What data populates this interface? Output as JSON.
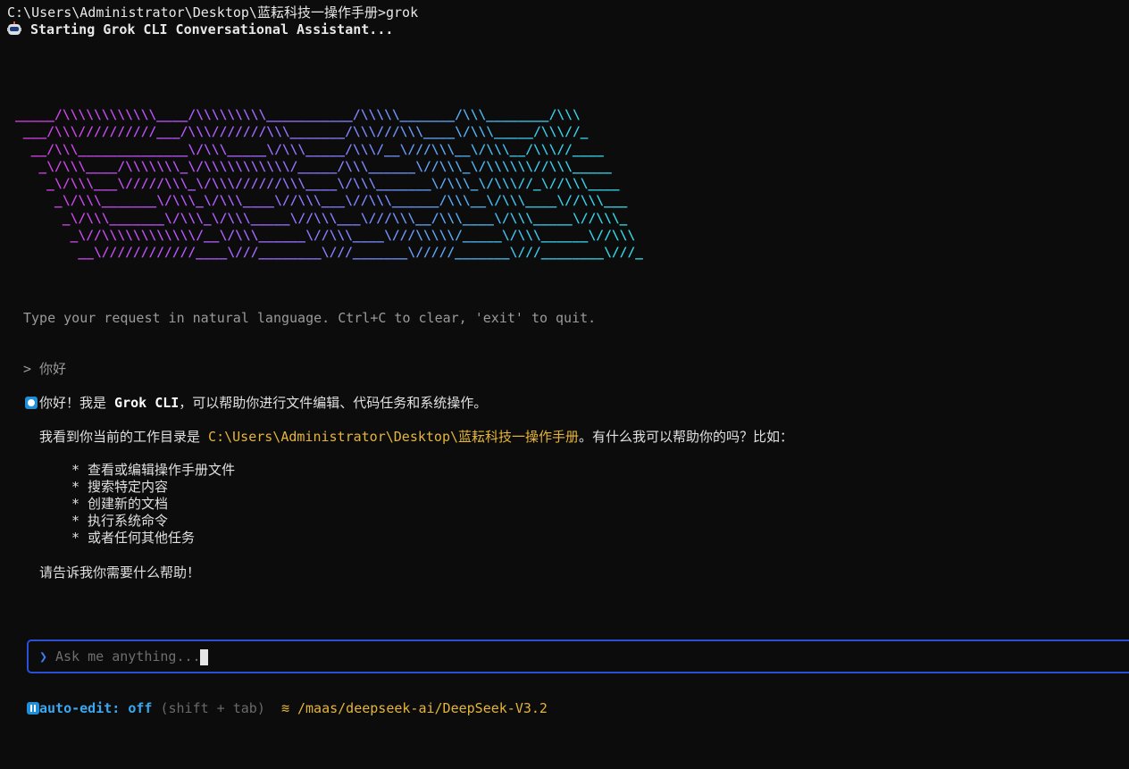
{
  "terminal": {
    "command_line": "C:\\Users\\Administrator\\Desktop\\蓝耘科技一操作手册>grok",
    "starting_text": "Starting Grok CLI Conversational Assistant..."
  },
  "banner": {
    "lines": [
      "_____/\\\\\\\\\\\\\\\\\\\\\\\\____/\\\\\\\\\\\\\\\\\\___________/\\\\\\\\\\_______/\\\\\\________/\\\\\\",
      " ___/\\\\\\//////////___/\\\\\\///////\\\\\\_______/\\\\\\///\\\\\\____\\/\\\\\\_____/\\\\\\//_",
      "  __/\\\\\\______________\\/\\\\\\_____\\/\\\\\\_____/\\\\\\/__\\///\\\\\\__\\/\\\\\\__/\\\\\\//____",
      "   _\\/\\\\\\____/\\\\\\\\\\\\\\_\\/\\\\\\\\\\\\\\\\\\\\\\/_____/\\\\\\______\\//\\\\\\_\\/\\\\\\\\\\\\//\\\\\\_____",
      "    _\\/\\\\\\___\\/////\\\\\\_\\/\\\\\\//////\\\\\\____\\/\\\\\\_______\\/\\\\\\_\\/\\\\\\//_\\//\\\\\\____",
      "     _\\/\\\\\\_______\\/\\\\\\_\\/\\\\\\____\\//\\\\\\___\\//\\\\\\______/\\\\\\__\\/\\\\\\____\\//\\\\\\___",
      "      _\\/\\\\\\_______\\/\\\\\\_\\/\\\\\\_____\\//\\\\\\___\\///\\\\\\__/\\\\\\____\\/\\\\\\_____\\//\\\\\\_",
      "       _\\//\\\\\\\\\\\\\\\\\\\\\\\\/__\\/\\\\\\______\\//\\\\\\____\\///\\\\\\\\\\/_____\\/\\\\\\______\\//\\\\\\",
      "        __\\////////////____\\///________\\///_______\\/////_______\\///________\\///_"
    ]
  },
  "hint_text": "Type your request in natural language. Ctrl+C to clear, 'exit' to quit.",
  "conversation": {
    "user_message": "> 你好",
    "reply_start": "你好！我是 ",
    "reply_name": "Grok CLI",
    "reply_end": "，可以帮助你进行文件编辑、代码任务和系统操作。",
    "dir_prefix": "我看到你当前的工作目录是 ",
    "dir_path": "C:\\Users\\Administrator\\Desktop\\蓝耘科技一操作手册",
    "dir_suffix": "。有什么我可以帮助你的吗？比如：",
    "bullets": [
      "* 查看或编辑操作手册文件",
      "* 搜索特定内容",
      "* 创建新的文档",
      "* 执行系统命令",
      "* 或者任何其他任务"
    ],
    "closing": "请告诉我你需要什么帮助！"
  },
  "input": {
    "prompt_symbol": "❯",
    "placeholder": "Ask me anything..."
  },
  "status_bar": {
    "auto_edit_label": "auto-edit:",
    "auto_edit_value": "off",
    "shortcut_hint": "(shift + tab)",
    "model_symbol": "≋",
    "model_path": "/maas/deepseek-ai/DeepSeek-V3.2"
  },
  "colors": {
    "background": "#0c0c0c",
    "accent_blue": "#3aa7f0",
    "path_gold": "#e5b53a",
    "input_border": "#2a4fd8"
  }
}
